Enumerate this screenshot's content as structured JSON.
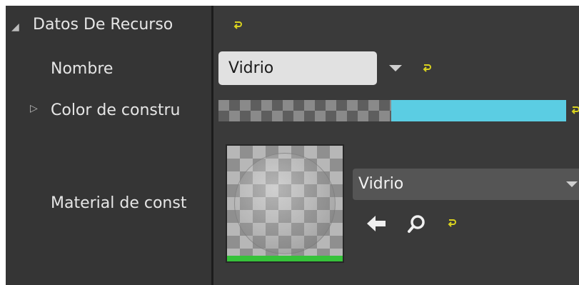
{
  "section": {
    "title": "Datos De Recurso"
  },
  "rows": {
    "nombre": {
      "label": "Nombre",
      "value": "Vidrio"
    },
    "color": {
      "label": "Color de constru",
      "color": "#5bcde3"
    },
    "material": {
      "label": "Material de const",
      "value": "Vidrio"
    }
  },
  "icons": {
    "collapse": "triangle-down-icon",
    "expand": "triangle-right-icon",
    "reset": "reset-to-default-icon",
    "use_selected": "left-arrow-icon",
    "browse": "search-icon",
    "combo_arrow": "chevron-down-icon"
  },
  "colors": {
    "reset_icon": "#d9d21f",
    "thumbnail_bar": "#36c23a"
  }
}
